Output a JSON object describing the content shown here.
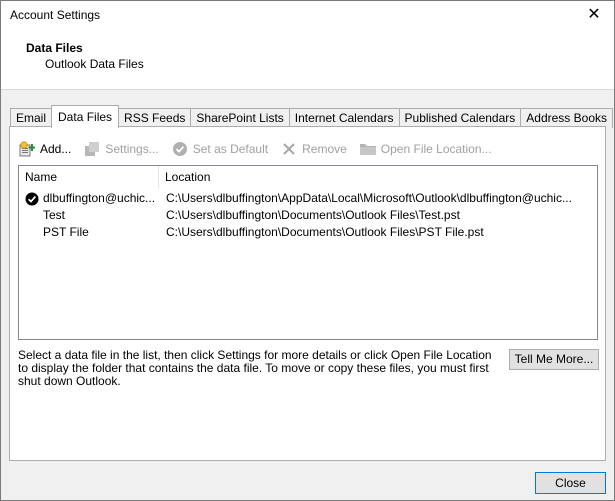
{
  "window": {
    "title": "Account Settings",
    "close_glyph": "✕"
  },
  "header": {
    "title": "Data Files",
    "subtitle": "Outlook Data Files"
  },
  "tabs": [
    {
      "label": "Email",
      "active": false
    },
    {
      "label": "Data Files",
      "active": true
    },
    {
      "label": "RSS Feeds",
      "active": false
    },
    {
      "label": "SharePoint Lists",
      "active": false
    },
    {
      "label": "Internet Calendars",
      "active": false
    },
    {
      "label": "Published Calendars",
      "active": false
    },
    {
      "label": "Address Books",
      "active": false
    }
  ],
  "toolbar": {
    "add": {
      "label": "Add...",
      "icon": "add-data-file-icon",
      "enabled": true
    },
    "settings": {
      "label": "Settings...",
      "icon": "settings-icon",
      "enabled": false
    },
    "set_default": {
      "label": "Set as Default",
      "icon": "checkmark-circle-icon",
      "enabled": false
    },
    "remove": {
      "label": "Remove",
      "icon": "x-icon",
      "enabled": false
    },
    "open_location": {
      "label": "Open File Location...",
      "icon": "folder-icon",
      "enabled": false
    }
  },
  "list": {
    "columns": [
      "Name",
      "Location"
    ],
    "rows": [
      {
        "name": "dlbuffington@uchic...",
        "location": "C:\\Users\\dlbuffington\\AppData\\Local\\Microsoft\\Outlook\\dlbuffington@uchic...",
        "is_default": true
      },
      {
        "name": "Test",
        "location": "C:\\Users\\dlbuffington\\Documents\\Outlook Files\\Test.pst",
        "is_default": false
      },
      {
        "name": "PST File",
        "location": "C:\\Users\\dlbuffington\\Documents\\Outlook Files\\PST File.pst",
        "is_default": false
      }
    ]
  },
  "help_text": "Select a data file in the list, then click Settings for more details or click Open File Location to display the folder that contains the data file. To move or copy these files, you must first shut down Outlook.",
  "buttons": {
    "tell_me_more": "Tell Me More...",
    "close": "Close"
  },
  "colors": {
    "accent_border": "#0078d7",
    "disabled_text": "#a0a0a0"
  }
}
